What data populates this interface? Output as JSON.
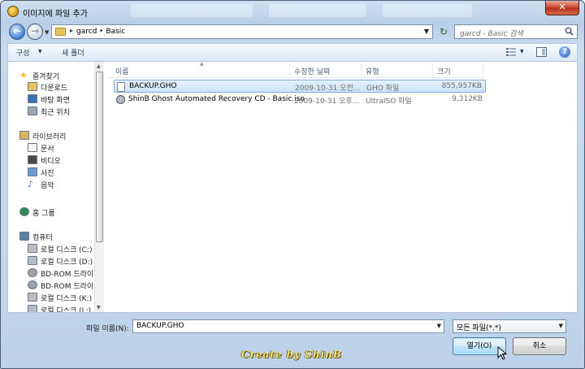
{
  "window": {
    "title": "이미지에 파일 추가",
    "close_label": "✕"
  },
  "navigation": {
    "back_label": "←",
    "forward_label": "→",
    "breadcrumb_separator": "▸",
    "breadcrumb": "garcd ‣ Basic",
    "search_placeholder": "garcd - Basic 검색",
    "refresh_label": "↻"
  },
  "toolbar": {
    "organize_label": "구성",
    "new_folder_label": "새 폴더",
    "help_label": "?"
  },
  "sidebar": {
    "items": [
      {
        "label": "즐겨찾기",
        "icon": "star-icon",
        "level": 0
      },
      {
        "label": "다운로드",
        "icon": "download-folder-icon",
        "level": 1
      },
      {
        "label": "바탕 화면",
        "icon": "desktop-icon",
        "level": 1
      },
      {
        "label": "최근 위치",
        "icon": "recent-places-icon",
        "level": 1
      },
      {
        "label": "라이브러리",
        "icon": "library-icon",
        "level": 0
      },
      {
        "label": "문서",
        "icon": "documents-icon",
        "level": 1
      },
      {
        "label": "비디오",
        "icon": "video-icon",
        "level": 1
      },
      {
        "label": "사진",
        "icon": "pictures-icon",
        "level": 1
      },
      {
        "label": "음악",
        "icon": "music-icon",
        "level": 1
      },
      {
        "label": "홈 그룹",
        "icon": "homegroup-icon",
        "level": 0
      },
      {
        "label": "컴퓨터",
        "icon": "computer-icon",
        "level": 0
      },
      {
        "label": "로컬 디스크 (C:)",
        "icon": "local-disk-icon",
        "level": 1
      },
      {
        "label": "로컬 디스크 (D:)",
        "icon": "local-disk-icon",
        "level": 1
      },
      {
        "label": "BD-ROM 드라이",
        "icon": "optical-drive-icon",
        "level": 1
      },
      {
        "label": "BD-ROM 드라이",
        "icon": "optical-drive-icon",
        "level": 1
      },
      {
        "label": "로컬 디스크 (K:)",
        "icon": "local-disk-icon",
        "level": 1
      },
      {
        "label": "로컬 디스크 (L:)",
        "icon": "local-disk-icon",
        "level": 1
      }
    ]
  },
  "file_list": {
    "columns": [
      "이름",
      "수정한 날짜",
      "유형",
      "크기"
    ],
    "rows": [
      {
        "name": "BACKUP.GHO",
        "date": "2009-10-31 오전...",
        "type": "GHO 파일",
        "size": "855,957KB",
        "icon": "document-icon",
        "selected": true
      },
      {
        "name": "ShinB Ghost Automated Recovery CD - Basic.iso",
        "date": "2009-10-31 오후...",
        "type": "UltraISO 파일",
        "size": "9,312KB",
        "icon": "disc-image-icon",
        "selected": false
      }
    ]
  },
  "footer": {
    "filename_label": "파일 이름(N):",
    "filename_value": "BACKUP.GHO",
    "filter_value": "모든 파일(*.*)",
    "open_label": "열기(O)",
    "cancel_label": "취소"
  },
  "watermark": "Create by ShinB",
  "colors": {
    "selection": "#cde3fb",
    "chrome": "#bcd2e9",
    "close_button": "#c9452f"
  }
}
